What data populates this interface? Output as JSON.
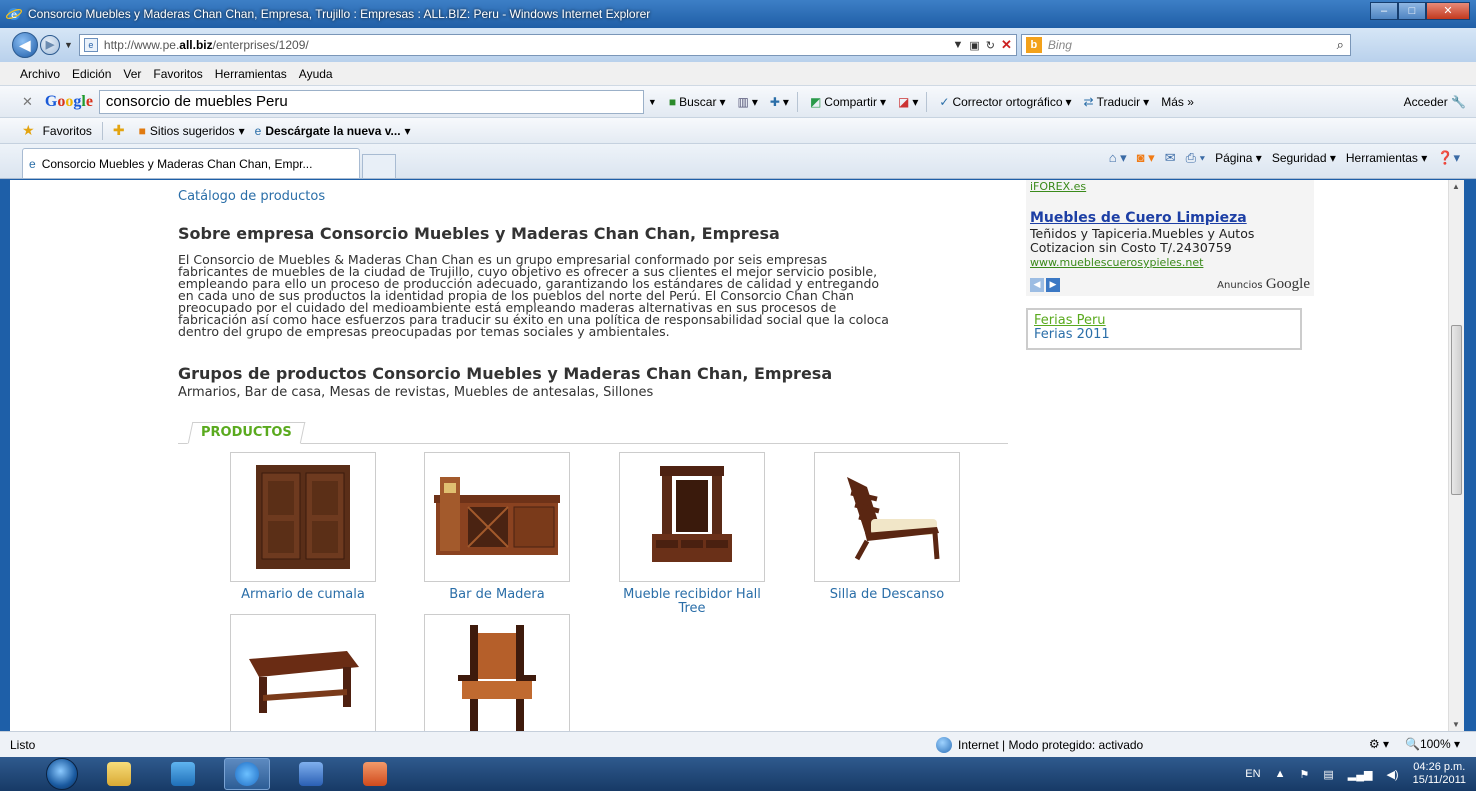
{
  "window": {
    "title": "Consorcio Muebles y Maderas Chan Chan, Empresa, Trujillo : Empresas : ALL.BIZ: Peru - Windows Internet Explorer",
    "buttons": [
      "minimize",
      "maximize",
      "close"
    ]
  },
  "address": {
    "url_prefix": "http://www.pe.",
    "url_bold": "all.biz",
    "url_suffix": "/enterprises/1209/",
    "search_placeholder": "Bing"
  },
  "menu": [
    "Archivo",
    "Edición",
    "Ver",
    "Favoritos",
    "Herramientas",
    "Ayuda"
  ],
  "google_toolbar": {
    "logo": "Google",
    "query": "consorcio de muebles Peru",
    "buscar": "Buscar",
    "compartir": "Compartir",
    "corrector": "Corrector ortográfico",
    "traducir": "Traducir",
    "mas": "Más »",
    "acceder": "Acceder"
  },
  "favorites_bar": {
    "favoritos": "Favoritos",
    "sitios": "Sitios sugeridos",
    "descargate": "Descárgate la nueva v..."
  },
  "tab": {
    "label": "Consorcio Muebles y Maderas Chan Chan, Empr..."
  },
  "command_bar": {
    "pagina": "Página",
    "seguridad": "Seguridad",
    "herramientas": "Herramientas"
  },
  "page": {
    "catalog_link": "Catálogo de productos",
    "about_heading": "Sobre empresa Consorcio Muebles y Maderas Chan Chan, Empresa",
    "about_lines": [
      "El Consorcio de Muebles & Maderas Chan Chan es un grupo empresarial conformado por seis empresas",
      "fabricantes de muebles de la ciudad de Trujillo, cuyo objetivo es ofrecer a sus clientes el mejor servicio posible,",
      "empleando para ello un proceso de producción adecuado, garantizando los estándares de calidad y entregando",
      "en cada uno de sus productos la identidad propia de los pueblos del norte del Perú. El Consorcio Chan Chan",
      "preocupado por el cuidado del medioambiente está empleando maderas alternativas en sus procesos de",
      "fabricación así como hace esfuerzos para traducir su éxito en una política de responsabilidad social que la coloca",
      "dentro del grupo de empresas preocupadas por temas sociales y ambientales."
    ],
    "groups_heading": "Grupos de productos Consorcio Muebles y Maderas Chan Chan, Empresa",
    "groups_text": "Armarios, Bar de casa, Mesas de revistas, Muebles de antesalas, Sillones",
    "products_tab": "PRODUCTOS",
    "products": [
      {
        "name": "Armario de cumala",
        "icon": "wardrobe-image"
      },
      {
        "name": "Bar de Madera",
        "icon": "bar-cabinet-image"
      },
      {
        "name": "Mueble recibidor Hall Tree",
        "icon": "hall-tree-image"
      },
      {
        "name": "Silla de Descanso",
        "icon": "lounge-chair-image"
      },
      {
        "name": "",
        "icon": "coffee-table-image"
      },
      {
        "name": "",
        "icon": "armchair-image"
      }
    ]
  },
  "ads": {
    "top_link": "iFOREX.es",
    "title": "Muebles de Cuero Limpieza",
    "line1": "Teñidos y Tapiceria.Muebles y Autos",
    "line2": "Cotizacion sin Costo T/.2430759",
    "url": "www.mueblescuerosypieles.net",
    "anuncios": "Anuncios",
    "google": "Google",
    "ferias": [
      "Ferias Peru",
      "Ferias 2011"
    ]
  },
  "status": {
    "left": "Listo",
    "zone": "Internet | Modo protegido: activado",
    "zoom": "100%"
  },
  "taskbar": {
    "lang": "EN",
    "time": "04:26 p.m.",
    "date": "15/11/2011"
  },
  "colors": {
    "link": "#2a6ea8",
    "accent_green": "#5aaa1e",
    "ad_title": "#1d3fa5"
  }
}
